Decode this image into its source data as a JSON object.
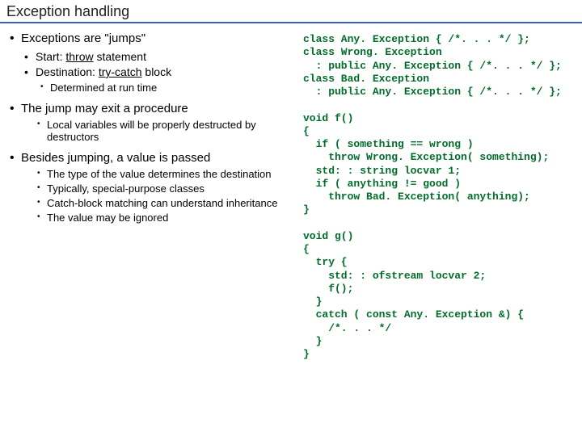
{
  "title": "Exception handling",
  "bullets": {
    "b1": "Exceptions are \"jumps\"",
    "b1a_pre": "Start: ",
    "b1a_u": "throw",
    "b1a_post": " statement",
    "b1b_pre": "Destination: ",
    "b1b_u": "try-catch",
    "b1b_post": " block",
    "b1b1": "Determined at run time",
    "b2": "The jump may exit a procedure",
    "b2a": "Local variables will be properly destructed by destructors",
    "b3": "Besides jumping, a value is passed",
    "b3a": "The type of the value determines the destination",
    "b3b": "Typically, special-purpose classes",
    "b3c": "Catch-block matching can understand inheritance",
    "b3d": "The value may be ignored"
  },
  "code": "class Any. Exception { /*. . . */ };\nclass Wrong. Exception\n  : public Any. Exception { /*. . . */ };\nclass Bad. Exception\n  : public Any. Exception { /*. . . */ };\n\nvoid f()\n{\n  if ( something == wrong )\n    throw Wrong. Exception( something);\n  std: : string locvar 1;\n  if ( anything != good )\n    throw Bad. Exception( anything);\n}\n\nvoid g()\n{\n  try {\n    std: : ofstream locvar 2;\n    f();\n  }\n  catch ( const Any. Exception &) {\n    /*. . . */\n  }\n}"
}
